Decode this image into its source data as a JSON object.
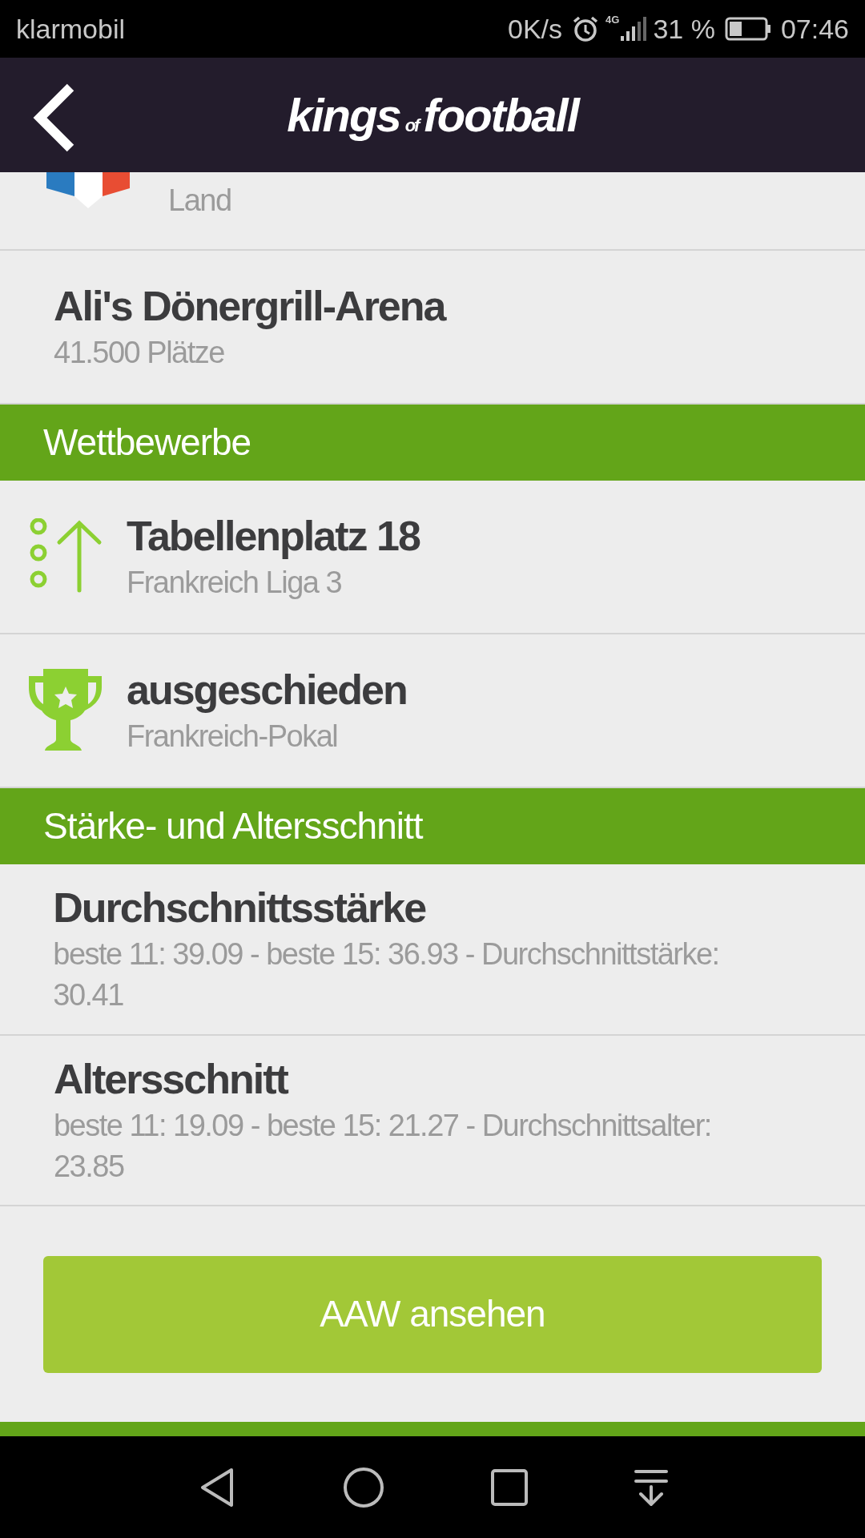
{
  "status_bar": {
    "carrier": "klarmobil",
    "speed": "0K/s",
    "network": "4G",
    "battery": "31 %",
    "time": "07:46"
  },
  "header": {
    "logo": [
      "kings",
      "of",
      "football"
    ]
  },
  "sections": [
    {
      "items": [
        {
          "kind": "flag",
          "subtitle": "Land"
        },
        {
          "kind": "plain",
          "title": "Ali's Dönergrill-Arena",
          "subtitle": "41.500 Plätze"
        }
      ]
    },
    {
      "title": "Wettbewerbe",
      "items": [
        {
          "kind": "ranking",
          "title": "Tabellenplatz 18",
          "subtitle": "Frankreich Liga 3"
        },
        {
          "kind": "cup",
          "title": "ausgeschieden",
          "subtitle": "Frankreich-Pokal"
        }
      ]
    },
    {
      "title": "Stärke- und Altersschnitt",
      "items": [
        {
          "kind": "plain",
          "title": "Durchschnittsstärke",
          "subtitle": "beste 11: 39.09 - beste 15: 36.93 - Durchschnittstärke: 30.41"
        },
        {
          "kind": "plain",
          "title": "Altersschnitt",
          "subtitle": "beste 11: 19.09 - beste 15: 21.27 - Durchschnittsalter: 23.85"
        }
      ]
    }
  ],
  "button": "AAW ansehen"
}
